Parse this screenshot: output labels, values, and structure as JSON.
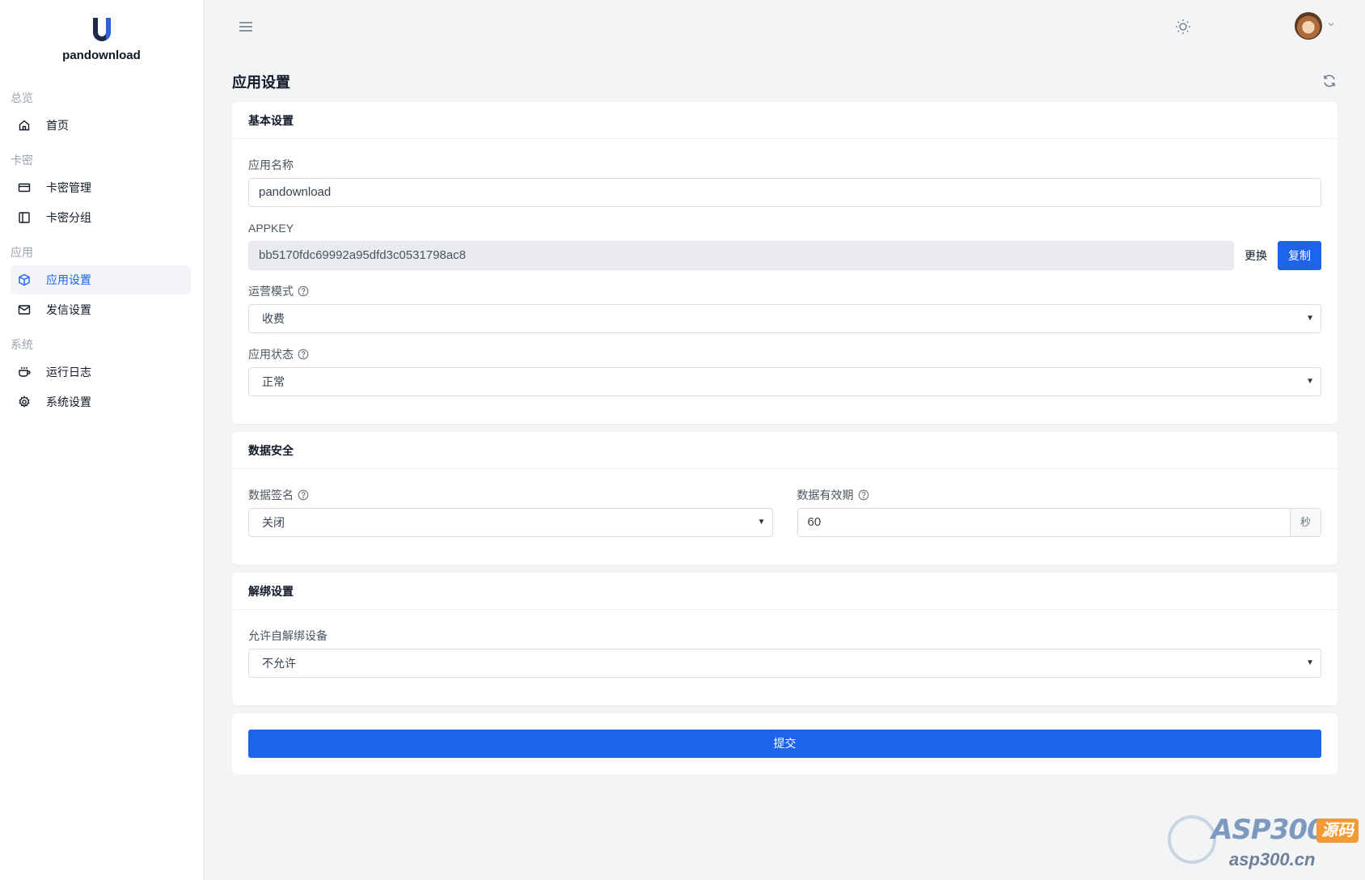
{
  "brand": {
    "name": "pandownload"
  },
  "sidebar": {
    "groups": [
      {
        "title": "总览",
        "items": [
          {
            "label": "首页",
            "icon": "home-icon"
          }
        ]
      },
      {
        "title": "卡密",
        "items": [
          {
            "label": "卡密管理",
            "icon": "card-icon"
          },
          {
            "label": "卡密分组",
            "icon": "sidebar-panel-icon"
          }
        ]
      },
      {
        "title": "应用",
        "items": [
          {
            "label": "应用设置",
            "icon": "cube-icon",
            "active": true
          },
          {
            "label": "发信设置",
            "icon": "mail-icon"
          }
        ]
      },
      {
        "title": "系统",
        "items": [
          {
            "label": "运行日志",
            "icon": "cup-icon"
          },
          {
            "label": "系统设置",
            "icon": "gear-icon"
          }
        ]
      }
    ]
  },
  "page": {
    "title": "应用设置"
  },
  "basic": {
    "title": "基本设置",
    "app_name_label": "应用名称",
    "app_name_value": "pandownload",
    "appkey_label": "APPKEY",
    "appkey_value": "bb5170fdc69992a95dfd3c0531798ac8",
    "replace_label": "更换",
    "copy_label": "复制",
    "mode_label": "运营模式",
    "mode_value": "收费",
    "status_label": "应用状态",
    "status_value": "正常"
  },
  "security": {
    "title": "数据安全",
    "sign_label": "数据签名",
    "sign_value": "关闭",
    "expire_label": "数据有效期",
    "expire_value": "60",
    "expire_unit": "秒"
  },
  "unbind": {
    "title": "解绑设置",
    "allow_label": "允许自解绑设备",
    "allow_value": "不允许"
  },
  "submit_label": "提交",
  "watermark": {
    "main": "ASP300",
    "badge": "源码",
    "sub": "asp300.cn"
  },
  "colors": {
    "primary": "#1d63ec",
    "background": "#f3f4f6"
  }
}
